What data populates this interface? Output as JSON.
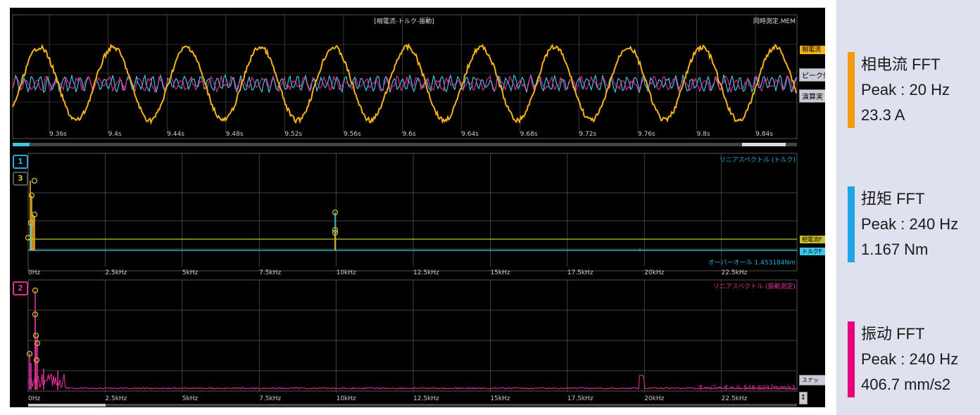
{
  "waveform": {
    "title": "[相電流-トルク-振動]",
    "filename": "同時測定.MEM",
    "time_ticks": [
      "9.36s",
      "9.4s",
      "9.44s",
      "9.48s",
      "9.52s",
      "9.56s",
      "9.6s",
      "9.64s",
      "9.68s",
      "9.72s",
      "9.76s",
      "9.8s",
      "9.84s"
    ],
    "channel_tab": "相電流",
    "buttons": [
      "ピーク値",
      "演算実"
    ]
  },
  "spectrum1": {
    "title": "リニアスペクトル (トルク)",
    "channel_numbers": [
      "1",
      "3"
    ],
    "freq_ticks": [
      "0Hz",
      "2.5kHz",
      "5kHz",
      "7.5kHz",
      "10kHz",
      "12.5kHz",
      "15kHz",
      "17.5kHz",
      "20kHz",
      "22.5kHz"
    ],
    "overall": "オーバーオール 1.453184Nm",
    "tabs": [
      "相電流F",
      "トルクF"
    ]
  },
  "spectrum2": {
    "title": "リニアスペクトル (振動測定)",
    "channel_numbers": [
      "2"
    ],
    "freq_ticks": [
      "0Hz",
      "2.5kHz",
      "5kHz",
      "7.5kHz",
      "10kHz",
      "12.5kHz",
      "15kHz",
      "17.5kHz",
      "20kHz",
      "22.5kHz"
    ],
    "overall": "オーバーオール 546.6037mm/s2",
    "side_button": "スナッ"
  },
  "legend": [
    {
      "name": "相电流 FFT",
      "peak": "Peak : 20 Hz",
      "value": "23.3 A",
      "color": "#f39c12"
    },
    {
      "name": "扭矩 FFT",
      "peak": "Peak : 240 Hz",
      "value": "1.167 Nm",
      "color": "#1ea7e4"
    },
    {
      "name": "振动 FFT",
      "peak": "Peak : 240 Hz",
      "value": "406.7 mm/s2",
      "color": "#e6007e"
    }
  ],
  "colors": {
    "yellow": "#f5b21b",
    "cyan": "#3cc6e8",
    "magenta": "#e0309a",
    "olive": "#c8c030",
    "grid": "#5a5a5a",
    "blue_label": "#29a9e0"
  }
}
